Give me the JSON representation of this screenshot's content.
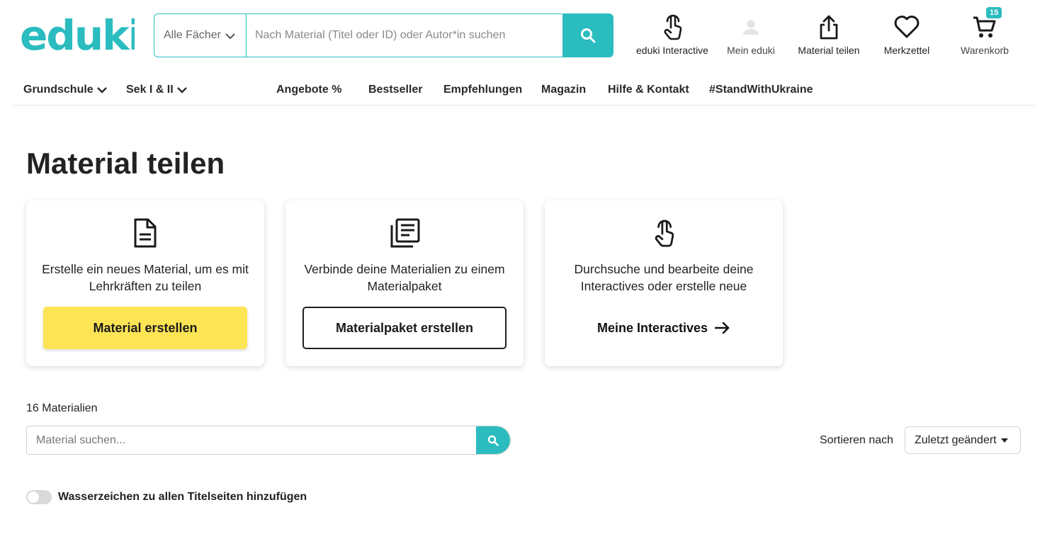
{
  "brand": {
    "logo_text": "eduki",
    "accent": "#2bbcbf",
    "yellow": "#fde455"
  },
  "search": {
    "subject_label": "Alle Fächer",
    "placeholder": "Nach Material (Titel oder ID) oder Autor*in suchen"
  },
  "header_nav": [
    {
      "label": "eduki Interactive",
      "icon": "touch-hand-icon"
    },
    {
      "label": "Mein eduki",
      "icon": "user-icon"
    },
    {
      "label": "Material teilen",
      "icon": "share-upload-icon"
    },
    {
      "label": "Merkzettel",
      "icon": "heart-icon"
    },
    {
      "label": "Warenkorb",
      "icon": "cart-icon",
      "badge": "15"
    }
  ],
  "category_nav": [
    {
      "label": "Grundschule",
      "dropdown": true
    },
    {
      "label": "Sek I & II",
      "dropdown": true
    },
    {
      "label": "Angebote %"
    },
    {
      "label": "Bestseller"
    },
    {
      "label": "Empfehlungen"
    },
    {
      "label": "Magazin"
    },
    {
      "label": "Hilfe & Kontakt"
    },
    {
      "label": "#StandWithUkraine"
    }
  ],
  "page": {
    "title": "Material teilen"
  },
  "cards": [
    {
      "icon": "document-icon",
      "text": "Erstelle ein neues Material, um es mit Lehrkräften zu teilen",
      "action": "Material erstellen"
    },
    {
      "icon": "bundle-icon",
      "text": "Verbinde deine Materialien zu einem Materialpaket",
      "action": "Materialpaket erstellen"
    },
    {
      "icon": "touch-hand-icon",
      "text": "Durchsuche und bearbeite deine Interactives oder erstelle neue",
      "action": "Meine Interactives"
    }
  ],
  "materials": {
    "count_label": "16 Materialien",
    "search_placeholder": "Material suchen...",
    "sort_label": "Sortieren nach",
    "sort_value": "Zuletzt geändert"
  },
  "watermark": {
    "label": "Wasserzeichen zu allen Titelseiten hinzufügen",
    "enabled": false
  }
}
